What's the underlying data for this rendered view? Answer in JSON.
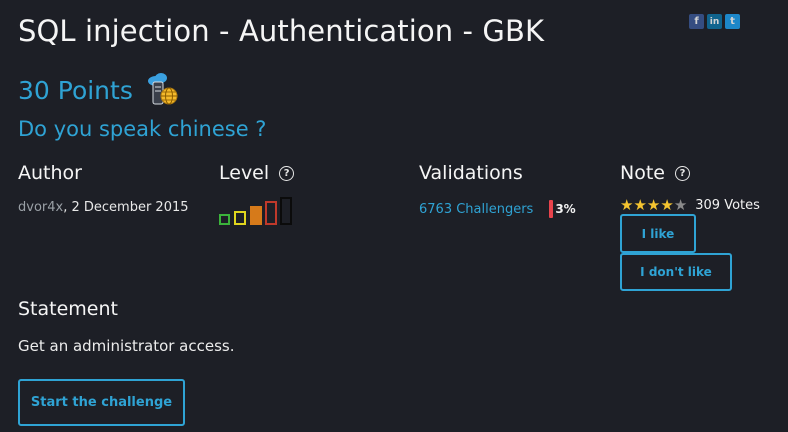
{
  "header": {
    "title": "SQL injection - Authentication - GBK",
    "share": {
      "facebook_glyph": "f",
      "linkedin_glyph": "in",
      "twitter_glyph": "t"
    }
  },
  "challenge": {
    "points": "30 Points",
    "category_icon": "web-server-icon",
    "subtitle": "Do you speak chinese ?"
  },
  "author": {
    "heading": "Author",
    "name": "dvor4x",
    "separator": ", ",
    "date": "2 December 2015"
  },
  "level": {
    "heading": "Level",
    "help": "?",
    "current_level": 3,
    "max_level": 5,
    "colors": [
      "#3bb33b",
      "#e0d51e",
      "#d67a1a",
      "#c0392b",
      "#111111"
    ]
  },
  "validations": {
    "heading": "Validations",
    "challengers": "6763 Challengers",
    "percent": "3%",
    "bar_color": "#e8434c"
  },
  "note": {
    "heading": "Note",
    "help": "?",
    "stars_filled": 4,
    "stars_total": 5,
    "votes": "309 Votes",
    "like_label": "I like",
    "dislike_label": "I don't like"
  },
  "statement": {
    "heading": "Statement",
    "text": "Get an administrator access.",
    "start_label": "Start the challenge"
  },
  "colors": {
    "background": "#1d1f26",
    "accent": "#2fa3d4",
    "star": "#f4c430"
  }
}
